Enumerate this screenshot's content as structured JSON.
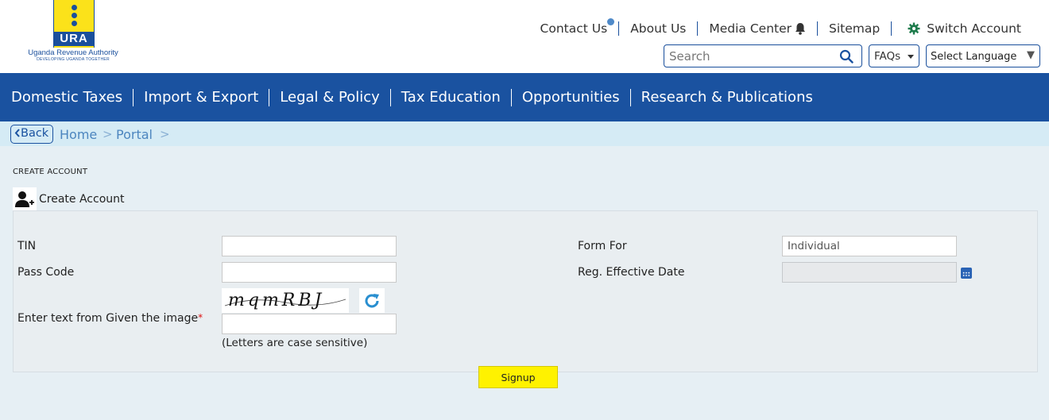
{
  "logo": {
    "abbr": "URA",
    "name": "Uganda Revenue Authority",
    "tagline": "DEVELOPING UGANDA TOGETHER"
  },
  "toplinks": {
    "contact": "Contact Us",
    "about": "About Us",
    "media": "Media Center",
    "sitemap": "Sitemap",
    "switch_account": "Switch Account"
  },
  "search": {
    "placeholder": "Search"
  },
  "faqs": {
    "label": "FAQs"
  },
  "language": {
    "label": "Select Language"
  },
  "nav": {
    "items": [
      "Domestic Taxes",
      "Import & Export",
      "Legal & Policy",
      "Tax Education",
      "Opportunities",
      "Research & Publications"
    ]
  },
  "breadcrumb": {
    "back": "Back",
    "home": "Home",
    "portal": "Portal",
    "sep": ">"
  },
  "page": {
    "section_label": "CREATE ACCOUNT",
    "panel_title": "Create Account"
  },
  "form": {
    "tin_label": "TIN",
    "tin_value": "",
    "passcode_label": "Pass Code",
    "passcode_value": "",
    "captcha_label": "Enter text from Given the image",
    "captcha_required": "*",
    "captcha_text": "mqmRBJ",
    "captcha_value": "",
    "case_hint": "(Letters are case sensitive)",
    "form_for_label": "Form For",
    "form_for_value": "Individual",
    "reg_date_label": "Reg. Effective Date",
    "reg_date_value": "",
    "signup": "Signup"
  },
  "colors": {
    "brand_blue": "#1a52a0",
    "logo_yellow": "#fbe21a",
    "signup_yellow": "#fff200",
    "gear_green": "#1e7b4c"
  }
}
